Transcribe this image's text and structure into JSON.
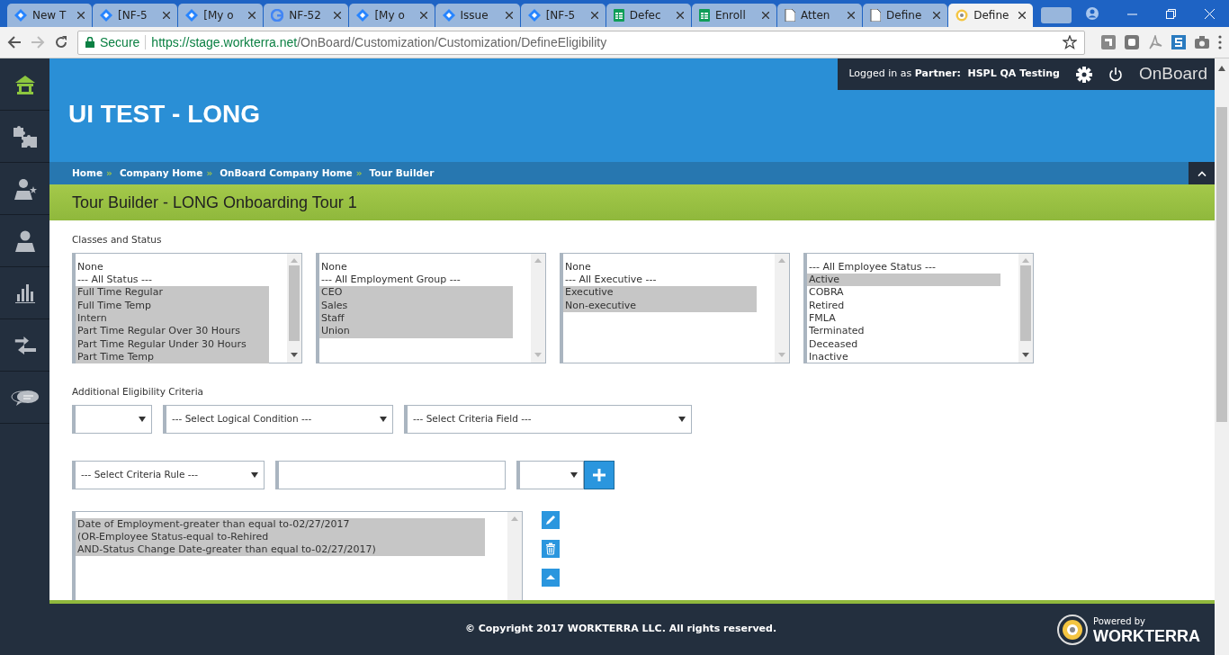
{
  "browser": {
    "tabs": [
      {
        "title": "New T",
        "kind": "diamond",
        "selected": false
      },
      {
        "title": "[NF-5",
        "kind": "diamond",
        "selected": false
      },
      {
        "title": "[My o",
        "kind": "diamond",
        "selected": false
      },
      {
        "title": "NF-52",
        "kind": "google",
        "selected": false
      },
      {
        "title": "[My o",
        "kind": "diamond",
        "selected": false
      },
      {
        "title": "Issue",
        "kind": "diamond",
        "selected": false
      },
      {
        "title": "[NF-5",
        "kind": "diamond",
        "selected": false
      },
      {
        "title": "Defec",
        "kind": "sheet",
        "selected": false
      },
      {
        "title": "Enroll",
        "kind": "sheet",
        "selected": false
      },
      {
        "title": "Atten",
        "kind": "doc",
        "selected": false
      },
      {
        "title": "Define",
        "kind": "doc",
        "selected": false
      },
      {
        "title": "Define",
        "kind": "target",
        "selected": true
      }
    ],
    "secure_label": "Secure",
    "url_host": "https://stage.workterra.net",
    "url_path": "/OnBoard/Customization/Customization/DefineEligibility"
  },
  "sidebar": {
    "items": [
      {
        "kind": "home",
        "selected": true
      },
      {
        "kind": "puzzle",
        "selected": false
      },
      {
        "kind": "person-star",
        "selected": false
      },
      {
        "kind": "person",
        "selected": false
      },
      {
        "kind": "chart",
        "selected": false
      },
      {
        "kind": "arrows",
        "selected": false
      },
      {
        "kind": "chat",
        "selected": false
      }
    ]
  },
  "header": {
    "title": "UI TEST - LONG",
    "login_prefix": "Logged in as",
    "login_role": "Partner:",
    "login_name": "HSPL QA Testing",
    "app_name": "OnBoard"
  },
  "breadcrumbs": {
    "separator": "»",
    "items": [
      "Home",
      "Company Home",
      "OnBoard Company Home",
      "Tour Builder"
    ]
  },
  "page_title": "Tour Builder - LONG Onboarding Tour 1",
  "classes_label": "Classes and Status",
  "listboxes": [
    {
      "options": [
        {
          "label": "None",
          "selected": false
        },
        {
          "label": "--- All Status ---",
          "selected": false
        },
        {
          "label": "Full Time Regular",
          "selected": true
        },
        {
          "label": "Full Time Temp",
          "selected": true
        },
        {
          "label": "Intern",
          "selected": true
        },
        {
          "label": "Part Time Regular Over 30 Hours",
          "selected": true
        },
        {
          "label": "Part Time Regular Under 30 Hours",
          "selected": true
        },
        {
          "label": "Part Time Temp",
          "selected": true
        }
      ]
    },
    {
      "options": [
        {
          "label": "None",
          "selected": false
        },
        {
          "label": "--- All Employment Group ---",
          "selected": false
        },
        {
          "label": "CEO",
          "selected": true
        },
        {
          "label": "Sales",
          "selected": true
        },
        {
          "label": "Staff",
          "selected": true
        },
        {
          "label": "Union",
          "selected": true
        }
      ]
    },
    {
      "options": [
        {
          "label": "None",
          "selected": false
        },
        {
          "label": "--- All Executive ---",
          "selected": false
        },
        {
          "label": "Executive",
          "selected": true
        },
        {
          "label": "Non-executive",
          "selected": true
        }
      ]
    },
    {
      "options": [
        {
          "label": "--- All Employee Status ---",
          "selected": false
        },
        {
          "label": "Active",
          "selected": true
        },
        {
          "label": "COBRA",
          "selected": false
        },
        {
          "label": "Retired",
          "selected": false
        },
        {
          "label": "FMLA",
          "selected": false
        },
        {
          "label": "Terminated",
          "selected": false
        },
        {
          "label": "Deceased",
          "selected": false
        },
        {
          "label": "Inactive",
          "selected": false
        }
      ]
    }
  ],
  "criteria_label": "Additional Eligibility Criteria",
  "criteria_row_1": [
    {
      "kind": "dropdown"
    },
    {
      "kind": "dropdown",
      "text": "--- Select Logical Condition ---"
    },
    {
      "kind": "dropdown",
      "text": "--- Select Criteria Field ---"
    }
  ],
  "criteria_row_2": [
    {
      "kind": "dropdown",
      "text": "--- Select Criteria Rule ---"
    },
    {
      "kind": "input"
    },
    {
      "kind": "dropdown"
    },
    {
      "kind": "add"
    }
  ],
  "criteria_list": [
    {
      "text": "Date of Employment-greater than equal to-02/27/2017",
      "selected": true
    },
    {
      "text": "(OR-Employee Status-equal to-Rehired",
      "selected": true
    },
    {
      "text": "AND-Status Change Date-greater than equal to-02/27/2017)",
      "selected": true
    }
  ],
  "criteria_actions": [
    {
      "kind": "edit"
    },
    {
      "kind": "delete"
    },
    {
      "kind": "move-up"
    }
  ],
  "footer": {
    "copyright": "© Copyright 2017 WORKTERRA LLC. All rights reserved.",
    "powered_by": "Powered by",
    "brand": "WORKTERRA"
  }
}
